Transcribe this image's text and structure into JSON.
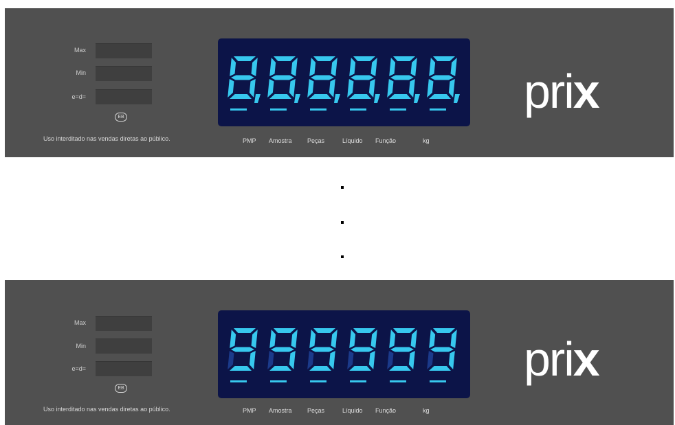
{
  "panels": [
    {
      "spec_labels": [
        "Max",
        "Min",
        "e=d="
      ],
      "badge": "EB",
      "notice": "Uso interditado nas vendas diretas ao público.",
      "display": {
        "reading": "8.8.8.8.8.8.",
        "digits": [
          "8",
          "8",
          "8",
          "8",
          "8",
          "8"
        ],
        "decimal_points": true
      },
      "annunciators": [
        "PMP",
        "Amostra",
        "Peças",
        "Líquido",
        "Função",
        "kg"
      ],
      "logo_thin": "pri",
      "logo_bold": "x"
    },
    {
      "spec_labels": [
        "Max",
        "Min",
        "e=d="
      ],
      "badge": "EB",
      "notice": "Uso interditado nas vendas diretas ao público.",
      "display": {
        "reading": "999999",
        "digits": [
          "9",
          "9",
          "9",
          "9",
          "9",
          "9"
        ],
        "decimal_points": false
      },
      "annunciators": [
        "PMP",
        "Amostra",
        "Peças",
        "Líquido",
        "Função",
        "kg"
      ],
      "logo_thin": "pri",
      "logo_bold": "x"
    }
  ],
  "separator": [
    "·",
    "·",
    "·"
  ],
  "colors": {
    "panel": "#505050",
    "display_bg": "#0c1448",
    "segment": "#37c8ee",
    "logo": "#ffffff"
  }
}
